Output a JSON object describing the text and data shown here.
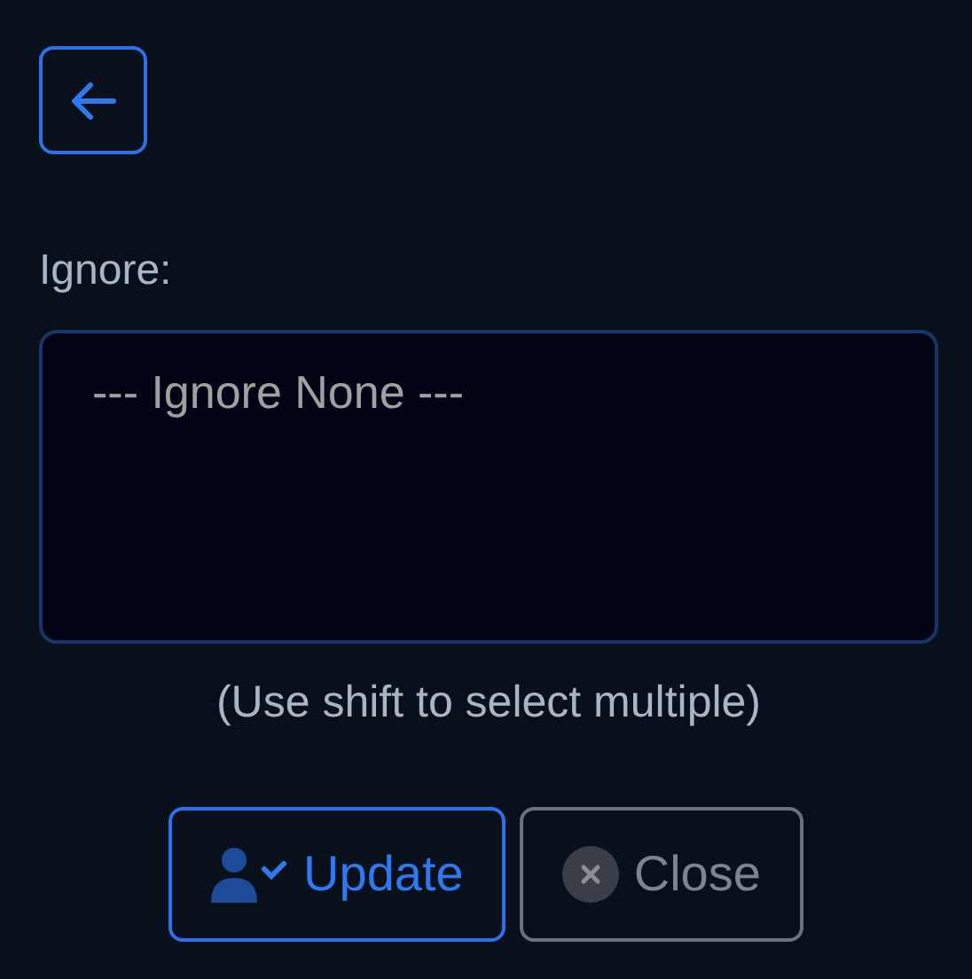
{
  "back_button": {
    "kind": "back"
  },
  "field": {
    "label": "Ignore:",
    "options": [
      {
        "label": "--- Ignore None ---",
        "selected": false
      }
    ],
    "hint": "(Use shift to select multiple)"
  },
  "buttons": [
    {
      "label": "Update",
      "kind": "primary"
    },
    {
      "label": "Close",
      "kind": "secondary"
    }
  ]
}
